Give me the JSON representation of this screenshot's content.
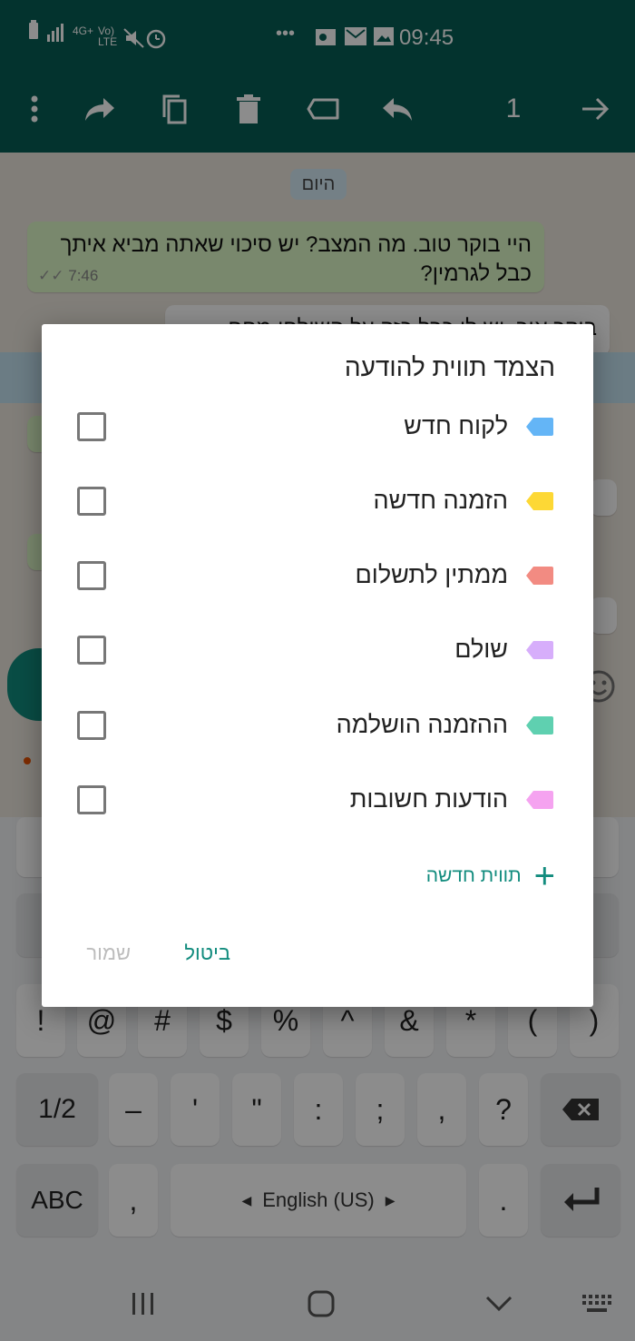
{
  "status_bar": {
    "network": "4G+",
    "volte": "Vo) LTE",
    "time": "09:45",
    "more": "•••"
  },
  "toolbar": {
    "selected_count": "1"
  },
  "chat": {
    "date_chip": "היום",
    "message_1": {
      "text": "היי בוקר טוב. מה המצב? יש סיכוי שאתה מביא איתך כבל לגרמין?",
      "time": "7:46"
    },
    "message_2_partial": "בוקר אור. יש לי כבל כזה על השולחן מחח"
  },
  "keyboard": {
    "row3": [
      "!",
      "@",
      "#",
      "$",
      "%",
      "^",
      "&",
      "*",
      "(",
      ")"
    ],
    "row4": [
      "1/2",
      "–",
      "'",
      "\"",
      ":",
      ";",
      ",",
      "?"
    ],
    "abc": "ABC",
    "comma": ",",
    "space": "English (US)",
    "period": "."
  },
  "dialog": {
    "title": "הצמד תווית להודעה",
    "options": [
      {
        "label": "לקוח חדש",
        "color": "#64b5f6",
        "checked": false
      },
      {
        "label": "הזמנה חדשה",
        "color": "#fdd835",
        "checked": false
      },
      {
        "label": "ממתין לתשלום",
        "color": "#f28b82",
        "checked": false
      },
      {
        "label": "שולם",
        "color": "#d7aefb",
        "checked": false
      },
      {
        "label": "ההזמנה הושלמה",
        "color": "#5fd0b0",
        "checked": false
      },
      {
        "label": "הודעות חשובות",
        "color": "#f5a3f0",
        "checked": false
      }
    ],
    "new_label": "תווית חדשה",
    "cancel": "ביטול",
    "save": "שמור"
  },
  "colors": {
    "header": "#075e54",
    "accent": "#128c7e",
    "disabled": "#bdbdbd"
  }
}
